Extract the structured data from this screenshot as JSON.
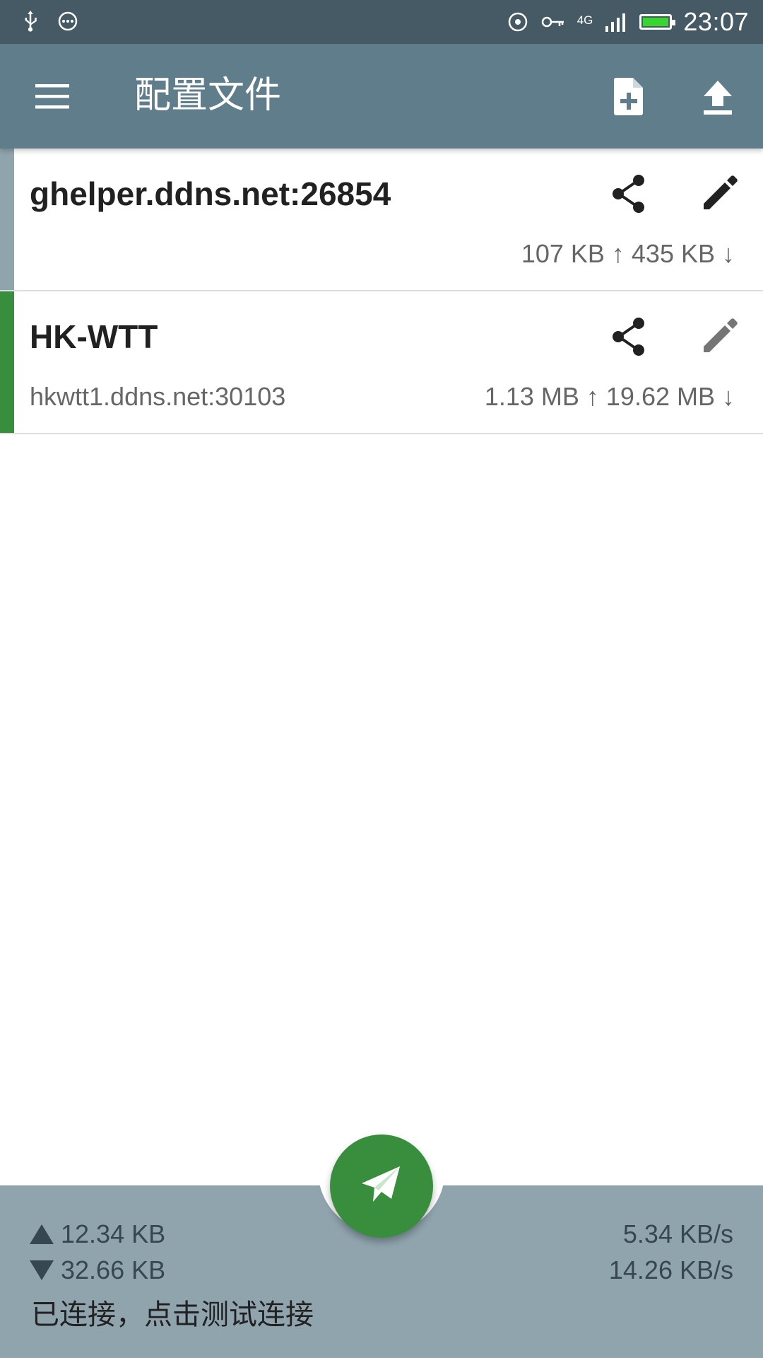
{
  "status_bar": {
    "time": "23:07",
    "network": "4G",
    "battery_color": "#38d430",
    "icons": [
      "usb-icon",
      "chat-icon",
      "sync-icon",
      "vpn-key-icon",
      "signal-icon",
      "battery-icon"
    ]
  },
  "appbar": {
    "title": "配置文件",
    "background": "#607d8b",
    "actions": [
      "add-file-icon",
      "upload-icon"
    ]
  },
  "profiles": [
    {
      "name": "ghelper.ddns.net:26854",
      "address": "",
      "traffic": "107 KB ↑ 435 KB ↓",
      "stripe_color": "#90a4ae",
      "edit_color": "#212121"
    },
    {
      "name": "HK-WTT",
      "address": "hkwtt1.ddns.net:30103",
      "traffic": "1.13 MB ↑ 19.62 MB ↓",
      "stripe_color": "#388e3c",
      "edit_color": "#757575"
    }
  ],
  "bottom": {
    "tx_total": "12.34 KB",
    "rx_total": "32.66 KB",
    "tx_rate": "5.34 KB/s",
    "rx_rate": "14.26 KB/s",
    "status": "已连接，点击测试连接",
    "fab_color": "#388e3c"
  }
}
